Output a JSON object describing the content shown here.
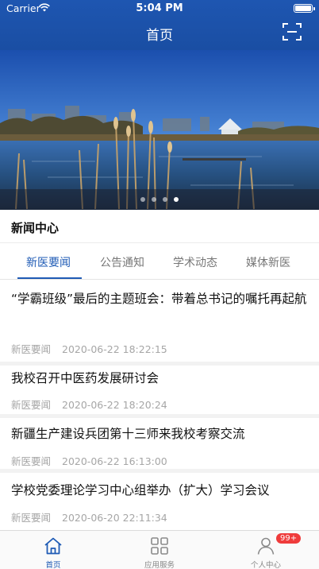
{
  "status_bar": {
    "carrier": "Carrier",
    "time": "5:04 PM"
  },
  "header": {
    "title": "首页"
  },
  "banner": {
    "image": "campus lake with reeds under blue sky",
    "slide_count": 4,
    "active_slide": 4
  },
  "news_center": {
    "title": "新闻中心",
    "tabs": [
      {
        "label": "新医要闻",
        "active": true
      },
      {
        "label": "公告通知",
        "active": false
      },
      {
        "label": "学术动态",
        "active": false
      },
      {
        "label": "媒体新医",
        "active": false
      }
    ],
    "items": [
      {
        "title": "“学霸班级”最后的主题班会：带着总书记的嘱托再起航",
        "source": "新医要闻",
        "time": "2020-06-22 18:22:15"
      },
      {
        "title": "我校召开中医药发展研讨会",
        "source": "新医要闻",
        "time": "2020-06-22 18:20:24"
      },
      {
        "title": "新疆生产建设兵团第十三师来我校考察交流",
        "source": "新医要闻",
        "time": "2020-06-22 16:13:00"
      },
      {
        "title": "学校党委理论学习中心组举办（扩大）学习会议",
        "source": "新医要闻",
        "time": "2020-06-20 22:11:34"
      }
    ]
  },
  "tabbar": {
    "items": [
      {
        "label": "首页",
        "icon": "home-icon",
        "active": true
      },
      {
        "label": "应用服务",
        "icon": "grid-icon",
        "active": false
      },
      {
        "label": "个人中心",
        "icon": "person-icon",
        "active": false,
        "badge": "99+"
      }
    ]
  },
  "colors": {
    "primary": "#1f5bb5",
    "badge": "#ef3b3b"
  }
}
